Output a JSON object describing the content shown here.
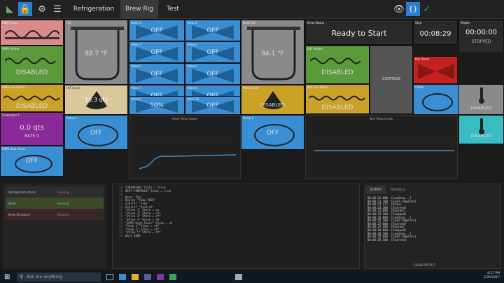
{
  "tabs": [
    "Refrigeration",
    "Brew Rig",
    "Test"
  ],
  "active_tab": "Brew Rig",
  "tiles": {
    "hlt_temp": "82.7 °F",
    "hlt_level": "15.3 qts",
    "mash_temp": "84.1 °F",
    "brew_status_label": "Brew Status",
    "brew_status": "Ready to Start",
    "step_label": "Step",
    "step_time": "00:08:29",
    "master_label": "Master",
    "master_time": "00:00:00",
    "master_state": "STOPPED",
    "continue": "CONTINUE",
    "disabled": "DISABLED",
    "off": "OFF",
    "valve_pct": "50%",
    "rate_value": "0.0 qts",
    "rate_label": "RATE 0",
    "mash_graph_title": "Mash Temp Graph",
    "boil_graph_title": "Boil Temp Graph"
  },
  "status_table": {
    "rows": [
      {
        "name": "Refrigeration Alarm",
        "value": "Running"
      },
      {
        "name": "Brew",
        "value": "Running"
      },
      {
        "name": "Brew Shutdown",
        "value": "Stopped"
      }
    ]
  },
  "output_panel": {
    "tabs": [
      "OUTPUT",
      "VARIABLES"
    ],
    "clear_label": "CLEAR OUTPUT",
    "lines": [
      "00:00:23.000  [Loading...]",
      "00:00:23.100  [Load complete]",
      "00:00:24.117  [Brew]",
      "00:00:24.500  [Started]",
      "00:00:25.000  [Paused]",
      "00:00:25.100  [Stopped]",
      "00:00:26.000  [Loading...]",
      "00:00:26.200  [Load complete]",
      "00:00:27.000  [Started]",
      "00:00:27.400  [Paused]",
      "00:00:28.000  [Stopped]",
      "00:00:28.500  [Loading...]",
      "00:00:29.000  [Load complete]",
      "00:00:29.200  [Started]"
    ]
  },
  "code_lines": [
    "CONTROLHAT State = false",
    "HEAT CONTROLHT State = true",
    "",
    "Note: This",
    "Deploy \"Pump TOOS\"",
    "Control \"Step\"",
    "Control \"Control\"",
    "\"Valve 1\" State = on",
    "\"Valve 2\" State = off",
    "\"Valve 3\" State = off",
    "\"Valve 4\" Value = 50",
    "\"RIMS High Power\" State = on",
    "\"Pump 1\" State = off",
    "\"Pump 2\" State = off",
    "\"Valve 5\" State = off",
    "Wait 5000"
  ],
  "code_line_numbers": [
    "10",
    "11",
    "12",
    "13",
    "14",
    "15",
    "16",
    "17",
    "18",
    "19",
    "20",
    "21",
    "22",
    "23",
    "24",
    "25"
  ],
  "taskbar": {
    "search_placeholder": "Ask me anything",
    "time": "4:17 PM",
    "date": "2/26/2017"
  },
  "colors": {
    "pink": "#d98a8a",
    "green": "#5a9a3a",
    "gray": "#8a8a8a",
    "gold": "#c9a227",
    "purple": "#8a2a9a",
    "blue": "#3a8fd4",
    "red": "#c42222",
    "cyan": "#3abcc4",
    "tan": "#d8c89a"
  }
}
